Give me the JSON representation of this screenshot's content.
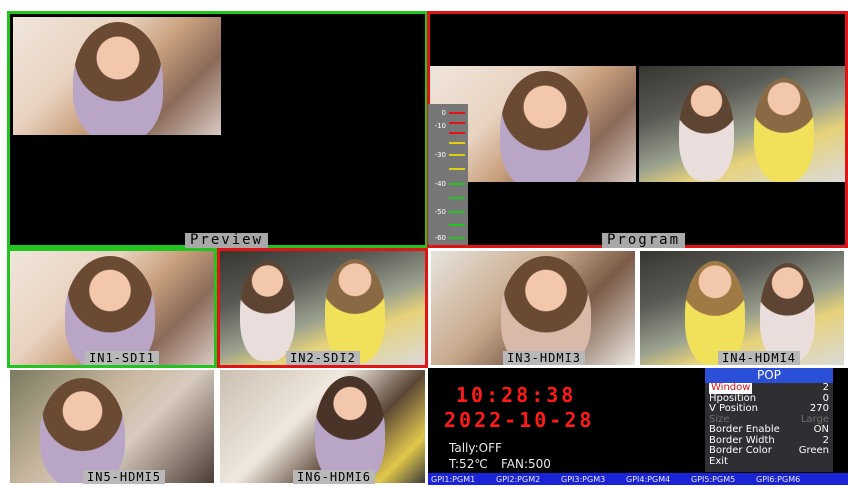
{
  "preview": {
    "label": "Preview"
  },
  "program": {
    "label": "Program"
  },
  "inputs": [
    {
      "label": "IN1-SDI1"
    },
    {
      "label": "IN2-SDI2"
    },
    {
      "label": "IN3-HDMI3"
    },
    {
      "label": "IN4-HDMI4"
    },
    {
      "label": "IN5-HDMI5"
    },
    {
      "label": "IN6-HDMI6"
    }
  ],
  "audio_meter": {
    "ticks": [
      "0",
      "-10",
      "-30",
      "-40",
      "-50",
      "-60"
    ]
  },
  "clock": {
    "time": "10:28:38",
    "date": "2022-10-28"
  },
  "status": {
    "tally": "Tally:OFF",
    "temp": "T:52℃",
    "fan": "FAN:500"
  },
  "gpi": [
    "GPI1:PGM1",
    "GPI2:PGM2",
    "GPI3:PGM3",
    "GPI4:PGM4",
    "GPI5:PGM5",
    "GPI6:PGM6"
  ],
  "pop_menu": {
    "title": "POP",
    "items": [
      {
        "label": "Window",
        "value": "2"
      },
      {
        "label": "Hposition",
        "value": "0"
      },
      {
        "label": "V Position",
        "value": "270"
      },
      {
        "label": "Size",
        "value": "Large"
      },
      {
        "label": "Border Enable",
        "value": "ON"
      },
      {
        "label": "Border Width",
        "value": "2"
      },
      {
        "label": "Border Color",
        "value": "Green"
      },
      {
        "label": "Exit",
        "value": ""
      }
    ]
  },
  "colors": {
    "preview_border": "#22c51f",
    "program_border": "#e01414",
    "clock": "#ff1a1a",
    "gpi_bar": "#1b23d6"
  }
}
